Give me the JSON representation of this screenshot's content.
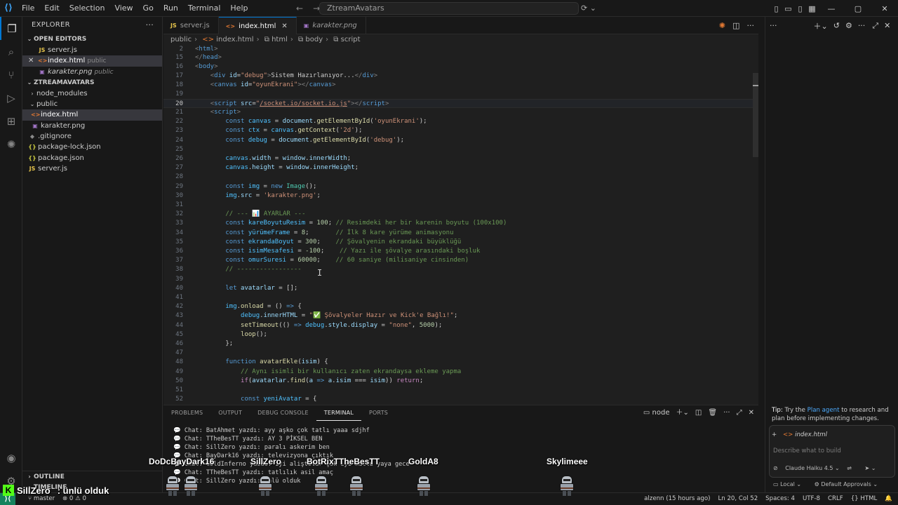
{
  "titlebar": {
    "menu": [
      "File",
      "Edit",
      "Selection",
      "View",
      "Go",
      "Run",
      "Terminal",
      "Help"
    ],
    "search": "ZtreamAvatars"
  },
  "sidebar": {
    "title": "EXPLORER",
    "open_editors_title": "OPEN EDITORS",
    "open_editors": [
      {
        "name": "server.js",
        "desc": "",
        "type": "js"
      },
      {
        "name": "index.html",
        "desc": "public",
        "type": "html"
      },
      {
        "name": "karakter.png",
        "desc": "public",
        "type": "png"
      }
    ],
    "project_title": "ZTREAMAVATARS",
    "tree": [
      {
        "name": "node_modules",
        "type": "folder"
      },
      {
        "name": "public",
        "type": "folder-open"
      },
      {
        "name": "index.html",
        "type": "html"
      },
      {
        "name": "karakter.png",
        "type": "png"
      },
      {
        "name": ".gitignore",
        "type": "git"
      },
      {
        "name": "package-lock.json",
        "type": "json"
      },
      {
        "name": "package.json",
        "type": "json"
      },
      {
        "name": "server.js",
        "type": "js"
      }
    ],
    "outline": "OUTLINE",
    "timeline": "TIMELINE"
  },
  "tabs": [
    {
      "label": "server.js",
      "icon": "JS"
    },
    {
      "label": "index.html",
      "icon": "<>"
    },
    {
      "label": "karakter.png",
      "icon": "img"
    }
  ],
  "breadcrumb": [
    "public",
    "index.html",
    "html",
    "body",
    "script"
  ],
  "panel": {
    "tabs": [
      "PROBLEMS",
      "OUTPUT",
      "DEBUG CONSOLE",
      "TERMINAL",
      "PORTS"
    ],
    "active_tab": "TERMINAL",
    "shell": "node",
    "lines": [
      "💬 Chat: BatAhmet yazdı: ayy aşko çok tatlı yaaa sdjhf",
      "💬 Chat: TTheBesTT yazdı: AY 3 PİKSEL BEN",
      "💬 Chat: SillZero yazdı: paralı askerim ben",
      "💬 Chat: BayDark16 yazdı: televizyona çıktık",
      "💬 Chat: GoldInferno yazdı: iyi aliştılar çok iyi mutlu yaya gece",
      "💬 Chat: TTheBesTT yazdı: tatlılık asil amaç",
      "💬 Chat: SillZero yazdı: ünlü olduk"
    ]
  },
  "game": {
    "names": [
      "DoDcBayDark16",
      "SillZero",
      "BotRixTTheBesTT",
      "GoldA8",
      "Skylimeee"
    ],
    "chat_name": "SillZero",
    "chat_message": ": ünlü olduk"
  },
  "chat": {
    "tip_label": "Tip:",
    "tip_text_1": "Try the",
    "tip_link": "Plan agent",
    "tip_text_2": "to research and plan before implementing changes.",
    "context_file": "index.html",
    "placeholder": "Describe what to build",
    "model": "Claude Haiku 4.5",
    "location": "Local",
    "approvals": "Default Approvals"
  },
  "statusbar": {
    "branch": "master",
    "errors": "0",
    "warnings": "0",
    "blame": "alzenn (15 hours ago)",
    "position": "Ln 20, Col 52",
    "spaces": "Spaces: 4",
    "encoding": "UTF-8",
    "eol": "CRLF",
    "language": "HTML"
  }
}
